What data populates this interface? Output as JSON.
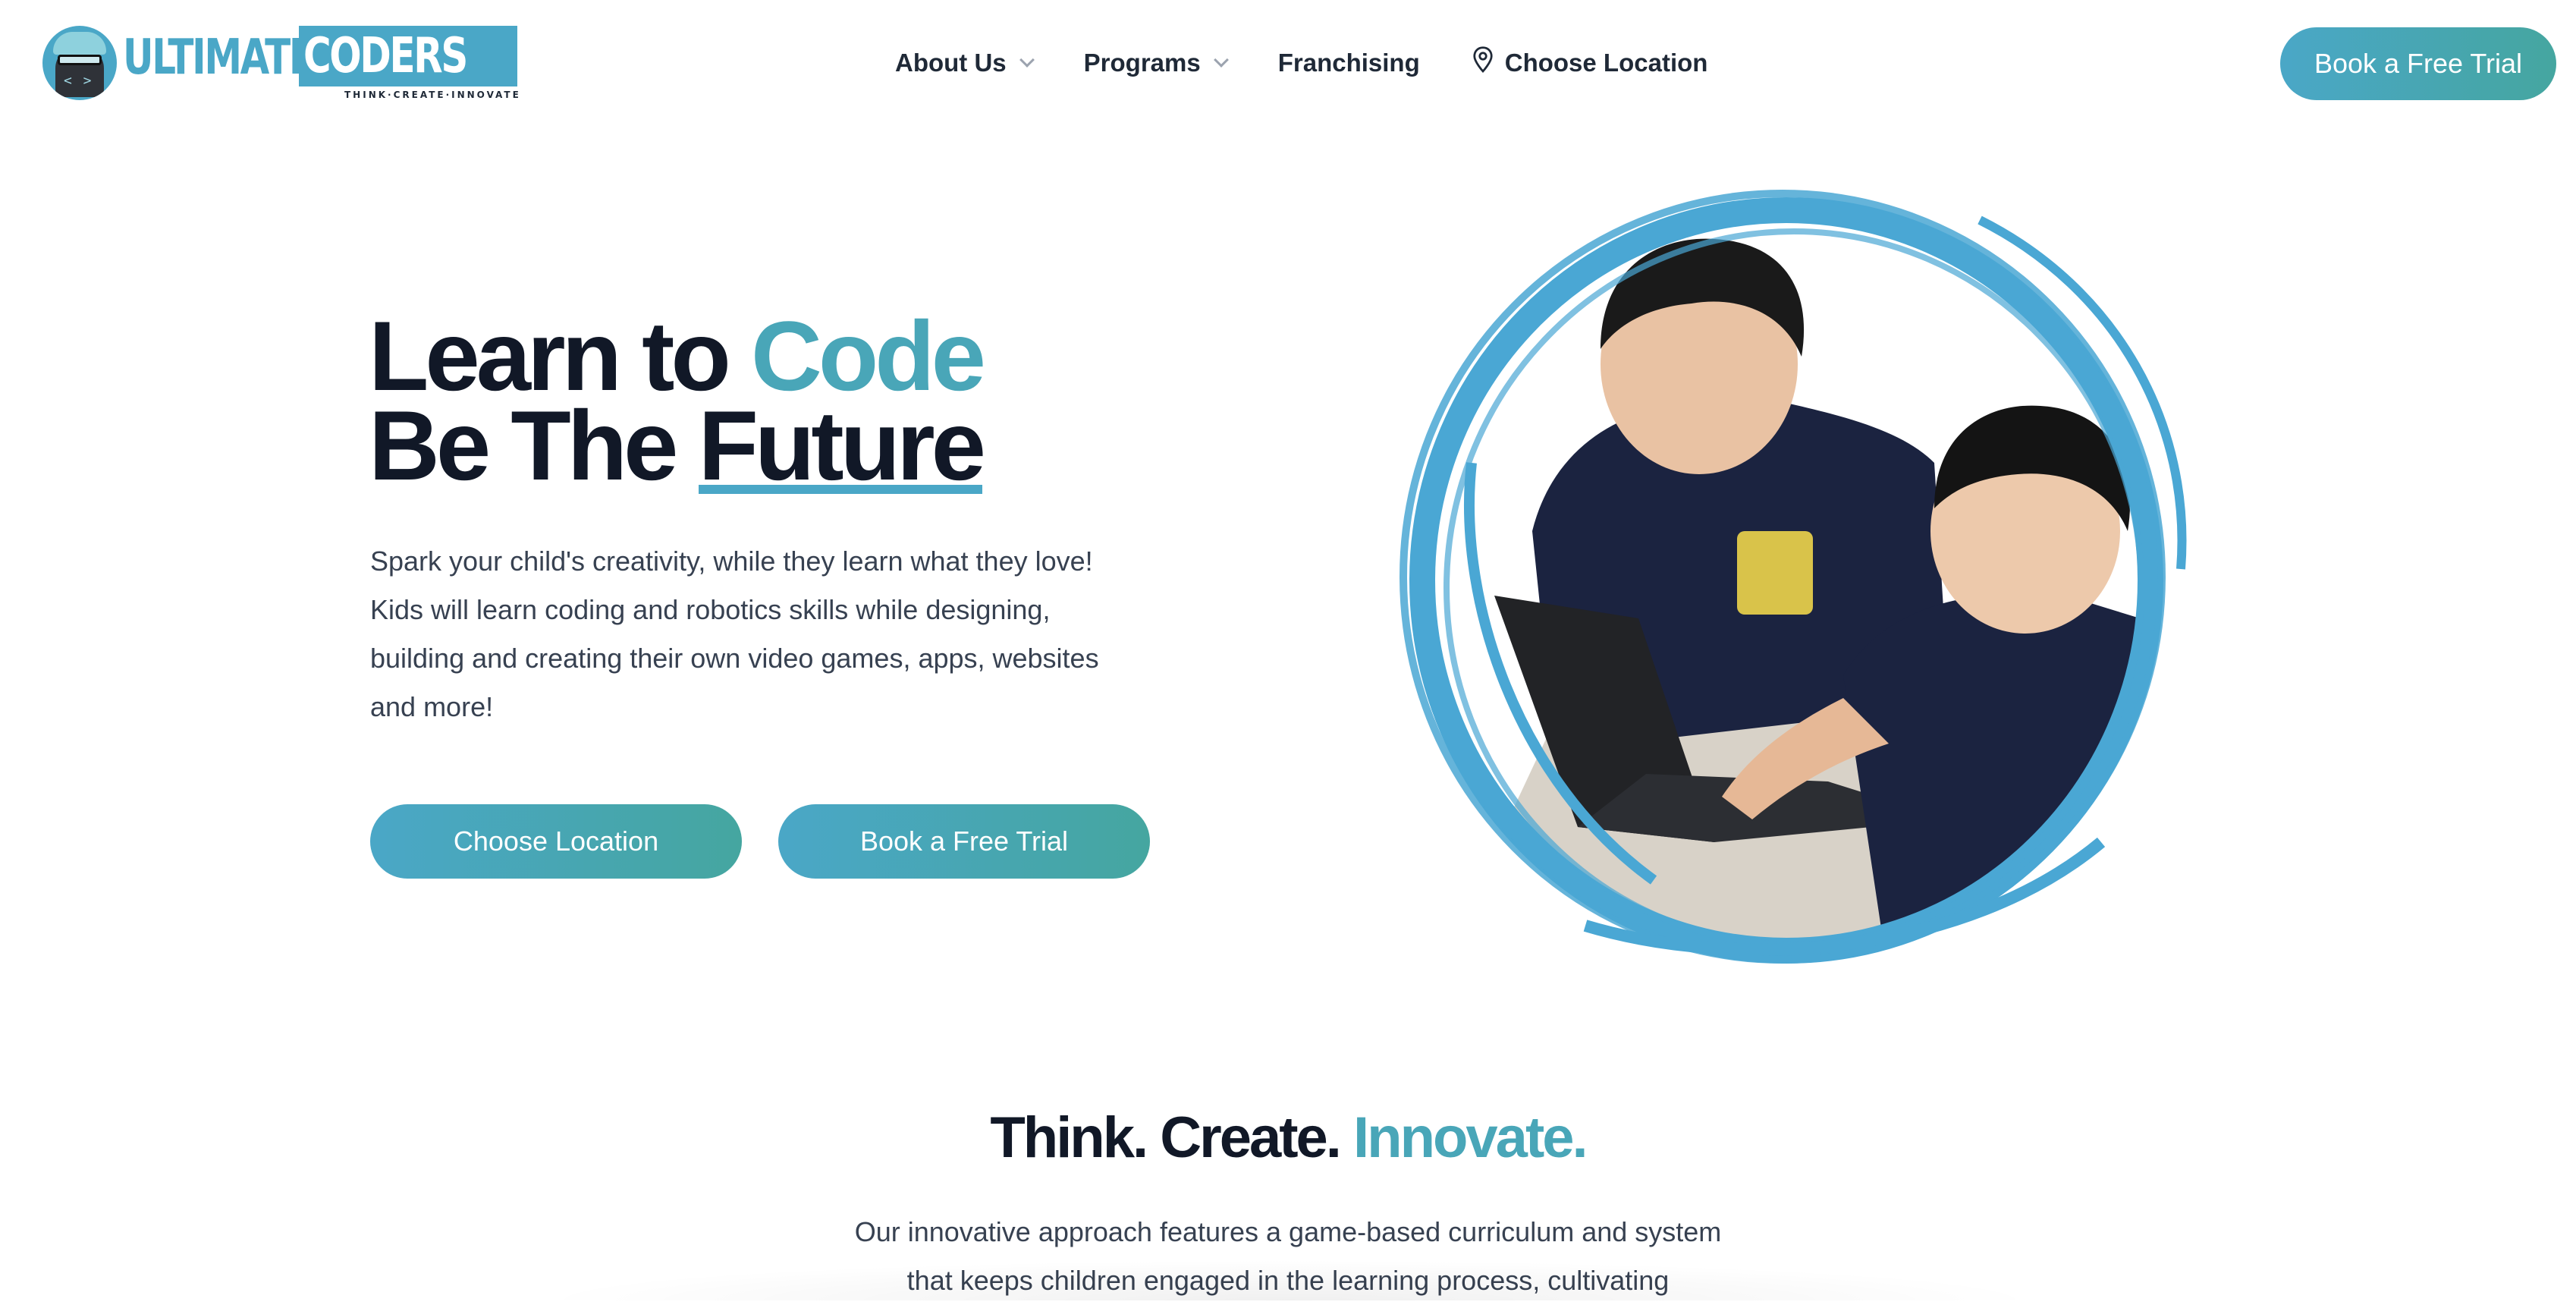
{
  "brand": {
    "word1": "ULTIMATE",
    "word2": "CODERS",
    "tagline": "THINK·CREATE·INNOVATE",
    "badge_code": "< >",
    "primary_color": "#4aa7c7",
    "secondary_color": "#45a6a0"
  },
  "nav": {
    "items": [
      {
        "label": "About Us",
        "icon": "chevron-down-icon"
      },
      {
        "label": "Programs",
        "icon": "chevron-down-icon"
      },
      {
        "label": "Franchising"
      },
      {
        "label": "Choose Location",
        "icon": "map-pin-icon"
      }
    ],
    "cta": "Book a Free Trial"
  },
  "hero": {
    "title_part1": "Learn to ",
    "title_accent": "Code",
    "title_line2_part1": "Be The ",
    "title_line2_underlined": "Future",
    "description": "Spark your child's creativity, while they learn what they love! Kids will learn coding and robotics skills while designing, building and creating their own video games, apps, websites and more!",
    "button_location": "Choose Location",
    "button_trial": "Book a Free Trial"
  },
  "section": {
    "title_part1": "Think. Create. ",
    "title_accent": "Innovate.",
    "description": "Our innovative approach features a game-based curriculum and system that keeps children engaged in the learning process, cultivating"
  }
}
